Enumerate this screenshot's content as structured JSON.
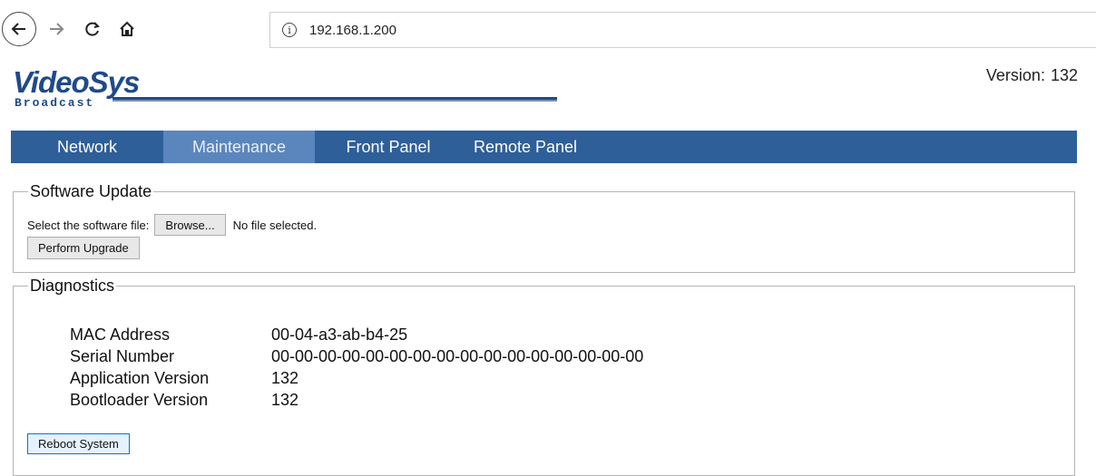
{
  "browser": {
    "url": "192.168.1.200",
    "icons": {
      "back": "back-arrow-icon",
      "forward": "forward-arrow-icon",
      "reload": "reload-icon",
      "home": "home-icon",
      "info": "info-icon"
    }
  },
  "header": {
    "logo_text": "VideoSys",
    "logo_subtext": "Broadcast",
    "version_label": "Version:",
    "version_value": "132"
  },
  "tabs": [
    {
      "label": "Network"
    },
    {
      "label": "Maintenance",
      "active": true
    },
    {
      "label": "Front Panel"
    },
    {
      "label": "Remote Panel"
    }
  ],
  "software_update": {
    "title": "Software Update",
    "select_label": "Select the software file:",
    "browse_label": "Browse...",
    "file_status": "No file selected.",
    "upgrade_label": "Perform Upgrade"
  },
  "diagnostics": {
    "title": "Diagnostics",
    "rows": [
      {
        "label": "MAC Address",
        "value": "00-04-a3-ab-b4-25"
      },
      {
        "label": "Serial Number",
        "value": "00-00-00-00-00-00-00-00-00-00-00-00-00-00-00-00"
      },
      {
        "label": "Application Version",
        "value": "132"
      },
      {
        "label": "Bootloader Version",
        "value": "132"
      }
    ],
    "reboot_label": "Reboot System"
  },
  "colors": {
    "tab_bar": "#2e5f99",
    "tab_active": "#5b86bd",
    "logo": "#1f4a8a"
  }
}
